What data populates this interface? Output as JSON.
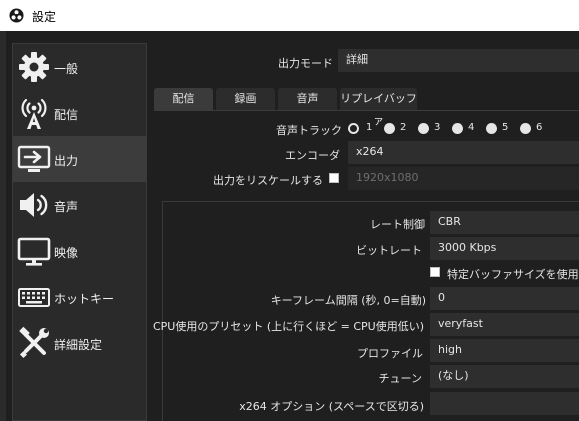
{
  "window": {
    "title": "設定"
  },
  "sidebar": {
    "items": [
      {
        "label": "一般",
        "icon": "gear-icon",
        "active": false
      },
      {
        "label": "配信",
        "icon": "broadcast-icon",
        "active": false
      },
      {
        "label": "出力",
        "icon": "output-icon",
        "active": true
      },
      {
        "label": "音声",
        "icon": "speaker-icon",
        "active": false
      },
      {
        "label": "映像",
        "icon": "monitor-icon",
        "active": false
      },
      {
        "label": "ホットキー",
        "icon": "keyboard-icon",
        "active": false
      },
      {
        "label": "詳細設定",
        "icon": "tools-icon",
        "active": false
      }
    ]
  },
  "output_mode": {
    "label": "出力モード",
    "value": "詳細"
  },
  "tabs": [
    {
      "label": "配信",
      "active": true
    },
    {
      "label": "録画",
      "active": false
    },
    {
      "label": "音声",
      "active": false
    },
    {
      "label": "リプレイバッファ",
      "active": false
    }
  ],
  "audio_track": {
    "label": "音声トラック",
    "options": [
      "1",
      "2",
      "3",
      "4",
      "5",
      "6"
    ],
    "selected": "1"
  },
  "encoder": {
    "label": "エンコーダ",
    "value": "x264"
  },
  "rescale": {
    "label": "出力をリスケールする",
    "checked": false,
    "value": "1920x1080"
  },
  "settings": {
    "rate_control": {
      "label": "レート制御",
      "value": "CBR"
    },
    "bitrate": {
      "label": "ビットレート",
      "value": "3000 Kbps"
    },
    "custom_buffer": {
      "label": "特定バッファサイズを使用",
      "checked": false
    },
    "keyframe": {
      "label": "キーフレーム間隔 (秒, 0=自動)",
      "value": "0"
    },
    "preset": {
      "label": "CPU使用のプリセット (上に行くほど = CPU使用低い)",
      "value": "veryfast"
    },
    "profile": {
      "label": "プロファイル",
      "value": "high"
    },
    "tune": {
      "label": "チューン",
      "value": "(なし)"
    },
    "x264opts": {
      "label": "x264 オプション (スペースで区切る)",
      "value": ""
    }
  },
  "colors": {
    "background": "#1f1f1f",
    "sidebar": "#2a2a2a",
    "active_item": "#3c3c3c",
    "field": "#2e2e2e",
    "text": "#e6e6e6",
    "titlebar": "#ffffff"
  }
}
